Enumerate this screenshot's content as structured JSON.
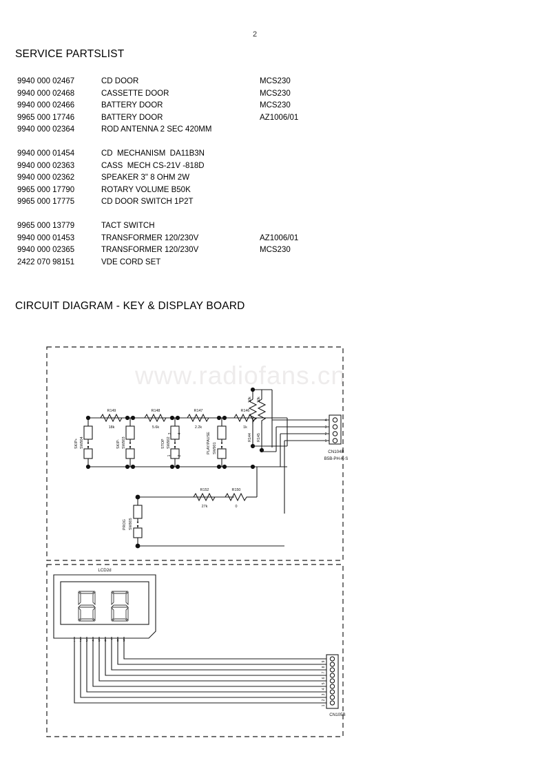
{
  "page": {
    "number": "2"
  },
  "partslist": {
    "title": "SERVICE PARTSLIST",
    "groups": [
      {
        "rows": [
          {
            "code": "9940 000 02467",
            "desc": "CD DOOR",
            "model": "MCS230"
          },
          {
            "code": "9940 000 02468",
            "desc": "CASSETTE DOOR",
            "model": "MCS230"
          },
          {
            "code": "9940 000 02466",
            "desc": "BATTERY DOOR",
            "model": "MCS230"
          },
          {
            "code": "9965 000 17746",
            "desc": "BATTERY DOOR",
            "model": "AZ1006/01"
          },
          {
            "code": "9940 000 02364",
            "desc": "ROD ANTENNA 2 SEC 420MM",
            "model": ""
          }
        ]
      },
      {
        "rows": [
          {
            "code": "9940 000 01454",
            "desc": "CD  MECHANISM  DA11B3N",
            "model": ""
          },
          {
            "code": "9940 000 02363",
            "desc": "CASS  MECH CS-21V -818D",
            "model": ""
          },
          {
            "code": "9940 000 02362",
            "desc": "SPEAKER 3\" 8 OHM 2W",
            "model": ""
          },
          {
            "code": "9965 000 17790",
            "desc": "ROTARY VOLUME B50K",
            "model": ""
          },
          {
            "code": "9965 000 17775",
            "desc": "CD DOOR SWITCH 1P2T",
            "model": ""
          }
        ]
      },
      {
        "rows": [
          {
            "code": "9965 000 13779",
            "desc": "TACT SWITCH",
            "model": ""
          },
          {
            "code": "9940 000 01453",
            "desc": "TRANSFORMER 120/230V",
            "model": "AZ1006/01"
          },
          {
            "code": "9940 000 02365",
            "desc": "TRANSFORMER 120/230V",
            "model": "MCS230"
          },
          {
            "code": "2422 070 98151",
            "desc": "VDE CORD SET",
            "model": ""
          }
        ]
      }
    ]
  },
  "circuit": {
    "title": "CIRCUIT DIAGRAM - KEY & DISPLAY BOARD",
    "watermark": "www.radiofans.cn",
    "switches": [
      {
        "ref": "SW904",
        "function": "SKIP+"
      },
      {
        "ref": "SW903",
        "function": "SKIP-"
      },
      {
        "ref": "SW902",
        "function": "STOP",
        "pins": [
          "3",
          "4",
          "1",
          "2"
        ]
      },
      {
        "ref": "SW901",
        "function": "PLAY/PAUSE"
      },
      {
        "ref": "SW905",
        "function": "PROG"
      }
    ],
    "resistors": [
      {
        "ref": "R149",
        "value": "18k"
      },
      {
        "ref": "R148",
        "value": "5.6k"
      },
      {
        "ref": "R147",
        "value": "2.2k"
      },
      {
        "ref": "R146",
        "value": "1k"
      },
      {
        "ref": "R144",
        "value": "10k"
      },
      {
        "ref": "R145",
        "value": "10k"
      },
      {
        "ref": "R152",
        "value": "27k"
      },
      {
        "ref": "R150",
        "value": "0"
      }
    ],
    "connectors": [
      {
        "ref": "CN104B",
        "type": "B5B-PH-K-S",
        "pins": [
          "4",
          "3",
          "2",
          "1"
        ]
      },
      {
        "ref": "CN105B",
        "type": "",
        "pins": [
          "9",
          "8",
          "7",
          "6",
          "5",
          "4",
          "3",
          "2",
          "1"
        ]
      }
    ],
    "display": {
      "ref": "LCD2d",
      "digits": 2,
      "pins": [
        "1",
        "2",
        "3",
        "4",
        "5",
        "6",
        "7",
        "8",
        "9"
      ]
    }
  }
}
